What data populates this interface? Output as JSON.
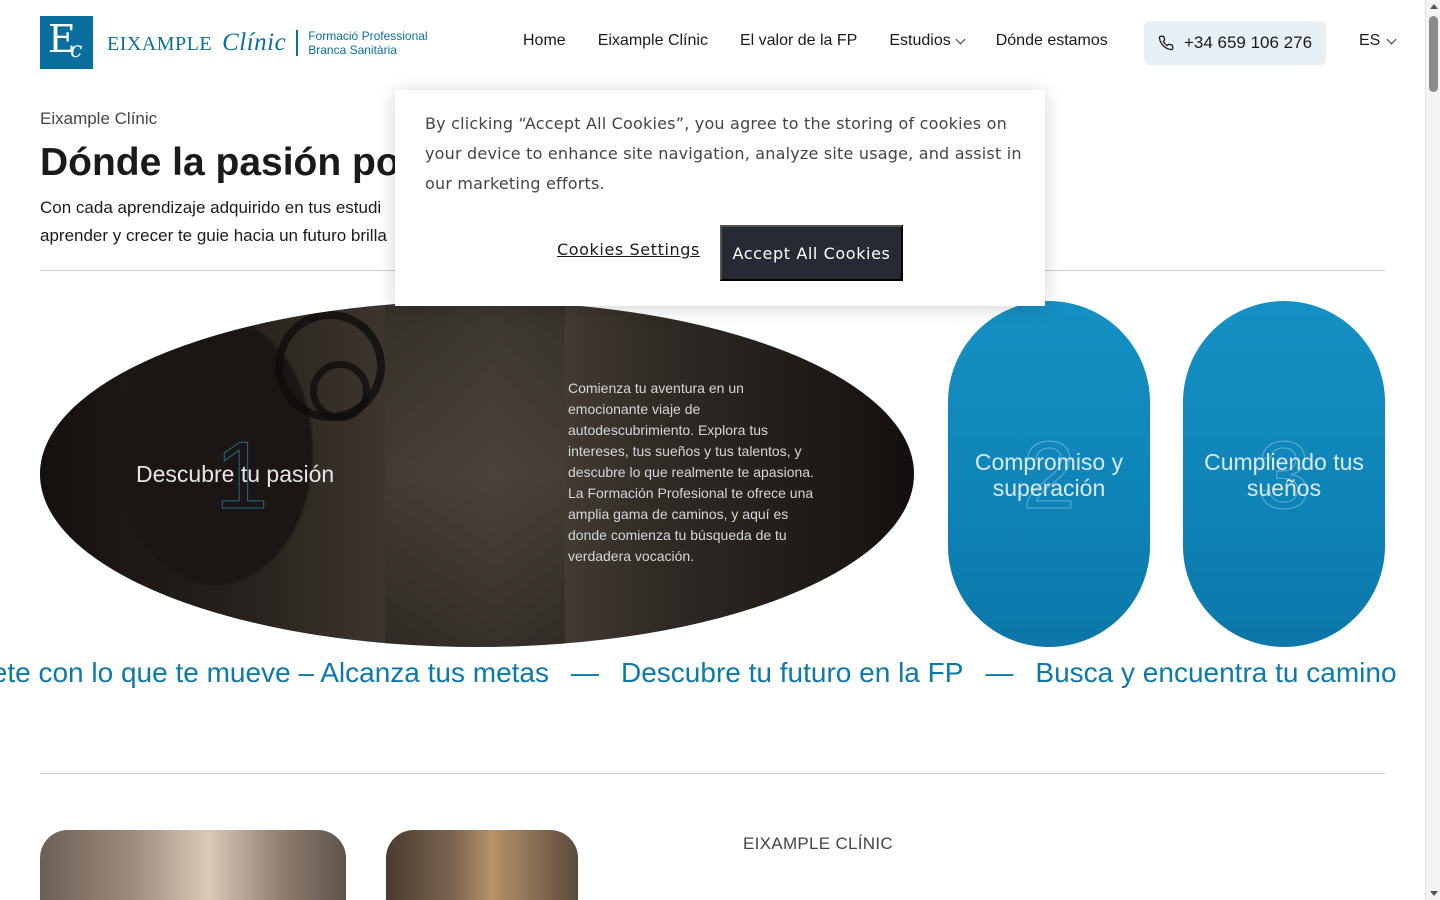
{
  "header": {
    "logo_mark_letter_1": "E",
    "logo_mark_letter_2": "c",
    "brand_1": "EIXAMPLE",
    "brand_2": "Clínic",
    "sub_line_1": "Formació Professional",
    "sub_line_2": "Branca Sanitària",
    "nav": [
      "Home",
      "Eixample Clínic",
      "El valor de la FP",
      "Estudios",
      "Dónde estamos"
    ],
    "phone": "+34 659 106 276",
    "lang": "ES"
  },
  "hero": {
    "eyebrow": "Eixample Clínic",
    "title": "Dónde la pasión por",
    "desc": "Con cada aprendizaje adquirido en tus estudi aprender y crecer te guie hacia un futuro brilla"
  },
  "cards": {
    "big": {
      "number": "1",
      "title": "Descubre tu pasión",
      "text": "Comienza tu aventura en un emocionante viaje de autodescubrimiento. Explora tus intereses, tus sueños y tus talentos, y descubre lo que realmente te apasiona. La Formación Profesional te ofrece una amplia gama de caminos, y aquí es donde comienza tu búsqueda de tu verdadera vocación."
    },
    "pill_1": {
      "number": "2",
      "title": "Compromiso y superación"
    },
    "pill_2": {
      "number": "3",
      "title": "Cumpliendo tus sueños"
    }
  },
  "marquee": {
    "items": [
      "stete con lo que te mueve – Alcanza tus metas",
      "Descubre tu futuro en la FP",
      "Busca y encuentra tu camino"
    ],
    "separator": "—"
  },
  "section": {
    "eyebrow": "EIXAMPLE CLÍNIC"
  },
  "cookie": {
    "text": "By clicking “Accept All Cookies”, you agree to the storing of cookies on your device to enhance site navigation, analyze site usage, and assist in our marketing efforts.",
    "settings_label": "Cookies Settings",
    "accept_label": "Accept All Cookies"
  },
  "colors": {
    "brand": "#0a6f9f",
    "accent_blue": "#1690c4",
    "cookie_button": "#262a33"
  }
}
